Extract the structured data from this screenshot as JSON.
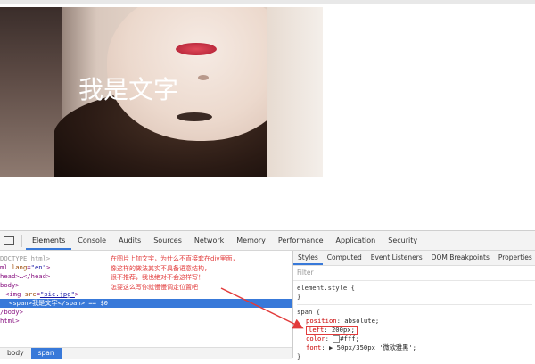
{
  "preview": {
    "overlay_text": "我是文字"
  },
  "devtools": {
    "tabs": [
      "Elements",
      "Console",
      "Audits",
      "Sources",
      "Network",
      "Memory",
      "Performance",
      "Application",
      "Security"
    ],
    "active_tab": "Elements",
    "dom_lines": {
      "l1": "DOCTYPE html>",
      "l2_a": "ml ",
      "l2_attr": "lang",
      "l2_val": "\"en\"",
      "l3": "head>…</head>",
      "l4": "body>",
      "l5_tag": "<img ",
      "l5_attr": "src",
      "l5_val": "\"pic.jpg\"",
      "l6_tag": "<span>",
      "l6_text": "我是文字",
      "l6_close": "</span>",
      "l6_suffix": " == $0",
      "l7": "/body>",
      "l8": "html>"
    },
    "annotation": [
      "在图片上加文字，为什么不直接套在div里面，",
      "像这样的做法其实不具备语意结构，",
      "很不推荐，我也绝对不会这样写！",
      "怎要这么写你就慢慢调定位置吧"
    ],
    "breadcrumbs": [
      "body",
      "span"
    ],
    "styles_tabs": [
      "Styles",
      "Computed",
      "Event Listeners",
      "DOM Breakpoints",
      "Properties"
    ],
    "filter_placeholder": "Filter",
    "element_style": "element.style {",
    "rule_selector": "span {",
    "props": {
      "position_name": "position",
      "position_val": "absolute;",
      "left_name": "left",
      "left_val": "200px;",
      "color_name": "color",
      "color_val": "#fff;",
      "font_name": "font",
      "font_val": "50px/350px '微软雅黑';"
    },
    "close_brace": "}"
  },
  "colors": {
    "accent": "#3879d9",
    "annotation": "#e23b3b"
  }
}
